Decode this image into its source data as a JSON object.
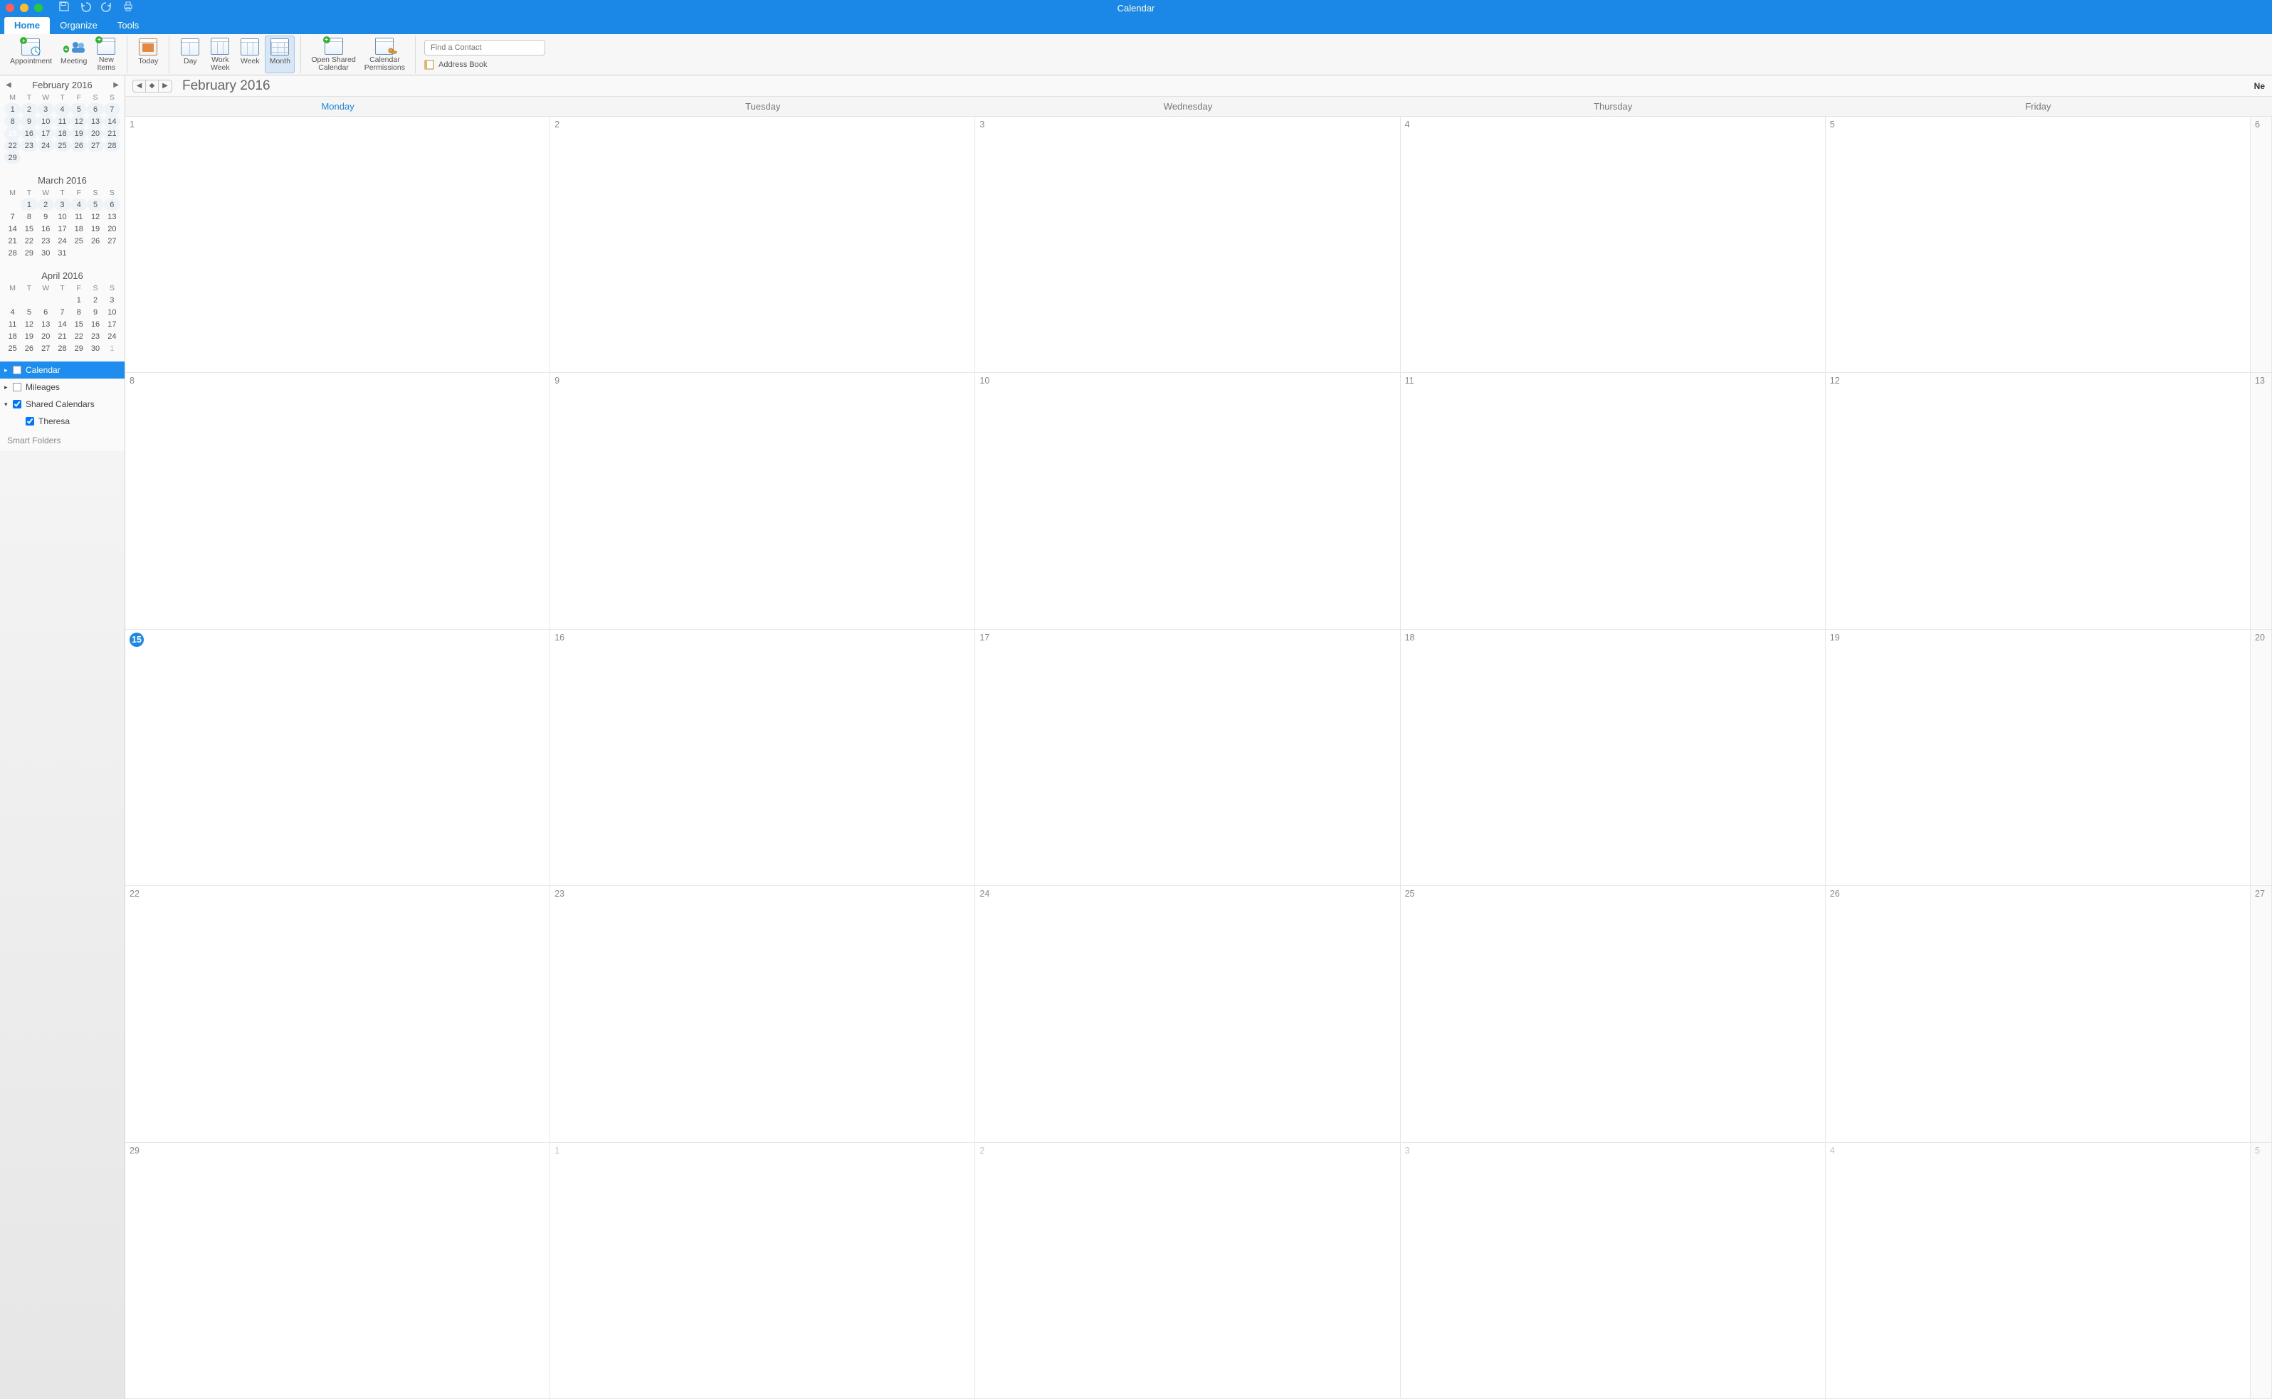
{
  "app_title": "Calendar",
  "menubar": {
    "tabs": [
      "Home",
      "Organize",
      "Tools"
    ],
    "active": 0
  },
  "ribbon": {
    "appointment": "Appointment",
    "meeting": "Meeting",
    "new_items": "New\nItems",
    "today": "Today",
    "day": "Day",
    "work_week": "Work\nWeek",
    "week": "Week",
    "month": "Month",
    "open_shared": "Open Shared\nCalendar",
    "permissions": "Calendar\nPermissions",
    "search_placeholder": "Find a Contact",
    "address_book": "Address Book"
  },
  "mini": {
    "dow": [
      "M",
      "T",
      "W",
      "T",
      "F",
      "S",
      "S"
    ],
    "months": [
      {
        "title": "February 2016",
        "nav": true,
        "weeks": [
          [
            "1",
            "2",
            "3",
            "4",
            "5",
            "6",
            "7"
          ],
          [
            "8",
            "9",
            "10",
            "11",
            "12",
            "13",
            "14"
          ],
          [
            "15",
            "16",
            "17",
            "18",
            "19",
            "20",
            "21"
          ],
          [
            "22",
            "23",
            "24",
            "25",
            "26",
            "27",
            "28"
          ],
          [
            "29",
            "",
            "",
            "",
            "",
            "",
            ""
          ]
        ],
        "today": [
          2,
          0
        ],
        "shade_all": true
      },
      {
        "title": "March 2016",
        "nav": false,
        "weeks": [
          [
            "",
            "1",
            "2",
            "3",
            "4",
            "5",
            "6"
          ],
          [
            "7",
            "8",
            "9",
            "10",
            "11",
            "12",
            "13"
          ],
          [
            "14",
            "15",
            "16",
            "17",
            "18",
            "19",
            "20"
          ],
          [
            "21",
            "22",
            "23",
            "24",
            "25",
            "26",
            "27"
          ],
          [
            "28",
            "29",
            "30",
            "31",
            "",
            "",
            ""
          ]
        ],
        "shade_rows": [
          0
        ]
      },
      {
        "title": "April 2016",
        "nav": false,
        "weeks": [
          [
            "",
            "",
            "",
            "",
            "1",
            "2",
            "3"
          ],
          [
            "4",
            "5",
            "6",
            "7",
            "8",
            "9",
            "10"
          ],
          [
            "11",
            "12",
            "13",
            "14",
            "15",
            "16",
            "17"
          ],
          [
            "18",
            "19",
            "20",
            "21",
            "22",
            "23",
            "24"
          ],
          [
            "25",
            "26",
            "27",
            "28",
            "29",
            "30",
            "1"
          ]
        ],
        "dim": [
          [
            4,
            6
          ]
        ]
      }
    ]
  },
  "calendars": {
    "items": [
      {
        "label": "Calendar",
        "checked": false,
        "selected": true,
        "disc": "▸",
        "color": true
      },
      {
        "label": "Mileages",
        "checked": false,
        "selected": false,
        "disc": "▸",
        "color": true
      },
      {
        "label": "Shared Calendars",
        "checked": true,
        "selected": false,
        "disc": "▾",
        "color": false
      },
      {
        "label": "Theresa",
        "checked": true,
        "selected": false,
        "disc": "",
        "color": false,
        "indent": true
      }
    ],
    "smart": "Smart Folders"
  },
  "main": {
    "title": "February 2016",
    "corner": "Ne",
    "weekdays": [
      "Monday",
      "Tuesday",
      "Wednesday",
      "Thursday",
      "Friday"
    ],
    "current_weekday": 0,
    "rows": [
      {
        "days": [
          "1",
          "2",
          "3",
          "4",
          "5"
        ],
        "sat": "6"
      },
      {
        "days": [
          "8",
          "9",
          "10",
          "11",
          "12"
        ],
        "sat": "13"
      },
      {
        "days": [
          "15",
          "16",
          "17",
          "18",
          "19"
        ],
        "sat": "20",
        "today": 0
      },
      {
        "days": [
          "22",
          "23",
          "24",
          "25",
          "26"
        ],
        "sat": "27"
      },
      {
        "days": [
          "29",
          "1",
          "2",
          "3",
          "4"
        ],
        "sat": "5",
        "dim": [
          1,
          2,
          3,
          4,
          5
        ]
      }
    ]
  }
}
